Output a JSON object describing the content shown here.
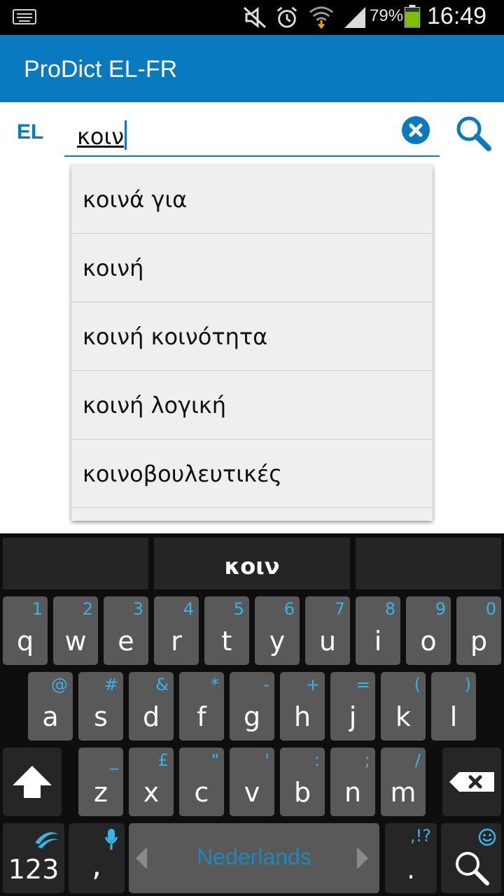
{
  "status_bar": {
    "battery_percent": "79%",
    "time": "16:49",
    "icons": [
      "keyboard-icon",
      "mute-icon",
      "alarm-icon",
      "wifi-icon",
      "signal-icon",
      "battery-icon"
    ]
  },
  "app": {
    "title": "ProDict EL-FR"
  },
  "search": {
    "language": "EL",
    "query": "κοιν"
  },
  "suggestions": [
    "κοινά για",
    "κοινή",
    "κοινή κοινότητα",
    "κοινή λογική",
    "κοινοβουλευτικές",
    ""
  ],
  "keyboard": {
    "prediction": "κοιν",
    "row1": [
      {
        "key": "q",
        "sec": "1"
      },
      {
        "key": "w",
        "sec": "2"
      },
      {
        "key": "e",
        "sec": "3"
      },
      {
        "key": "r",
        "sec": "4"
      },
      {
        "key": "t",
        "sec": "5"
      },
      {
        "key": "y",
        "sec": "6"
      },
      {
        "key": "u",
        "sec": "7"
      },
      {
        "key": "i",
        "sec": "8"
      },
      {
        "key": "o",
        "sec": "9"
      },
      {
        "key": "p",
        "sec": "0"
      }
    ],
    "row2": [
      {
        "key": "a",
        "sec": "@"
      },
      {
        "key": "s",
        "sec": "#"
      },
      {
        "key": "d",
        "sec": "&"
      },
      {
        "key": "f",
        "sec": "*"
      },
      {
        "key": "g",
        "sec": "-"
      },
      {
        "key": "h",
        "sec": "+"
      },
      {
        "key": "j",
        "sec": "="
      },
      {
        "key": "k",
        "sec": "("
      },
      {
        "key": "l",
        "sec": ")"
      }
    ],
    "row3": [
      {
        "key": "z",
        "sec": "_"
      },
      {
        "key": "x",
        "sec": "£"
      },
      {
        "key": "c",
        "sec": "\""
      },
      {
        "key": "v",
        "sec": "'"
      },
      {
        "key": "b",
        "sec": ":"
      },
      {
        "key": "n",
        "sec": ";"
      },
      {
        "key": "m",
        "sec": "/"
      }
    ],
    "numbers_key": "123",
    "comma_key": ",",
    "space_language": "Nederlands",
    "period_key": ".",
    "period_sec": ",!?",
    "accent_color": "#33b5e5"
  },
  "colors": {
    "primary": "#0a7ac0"
  }
}
